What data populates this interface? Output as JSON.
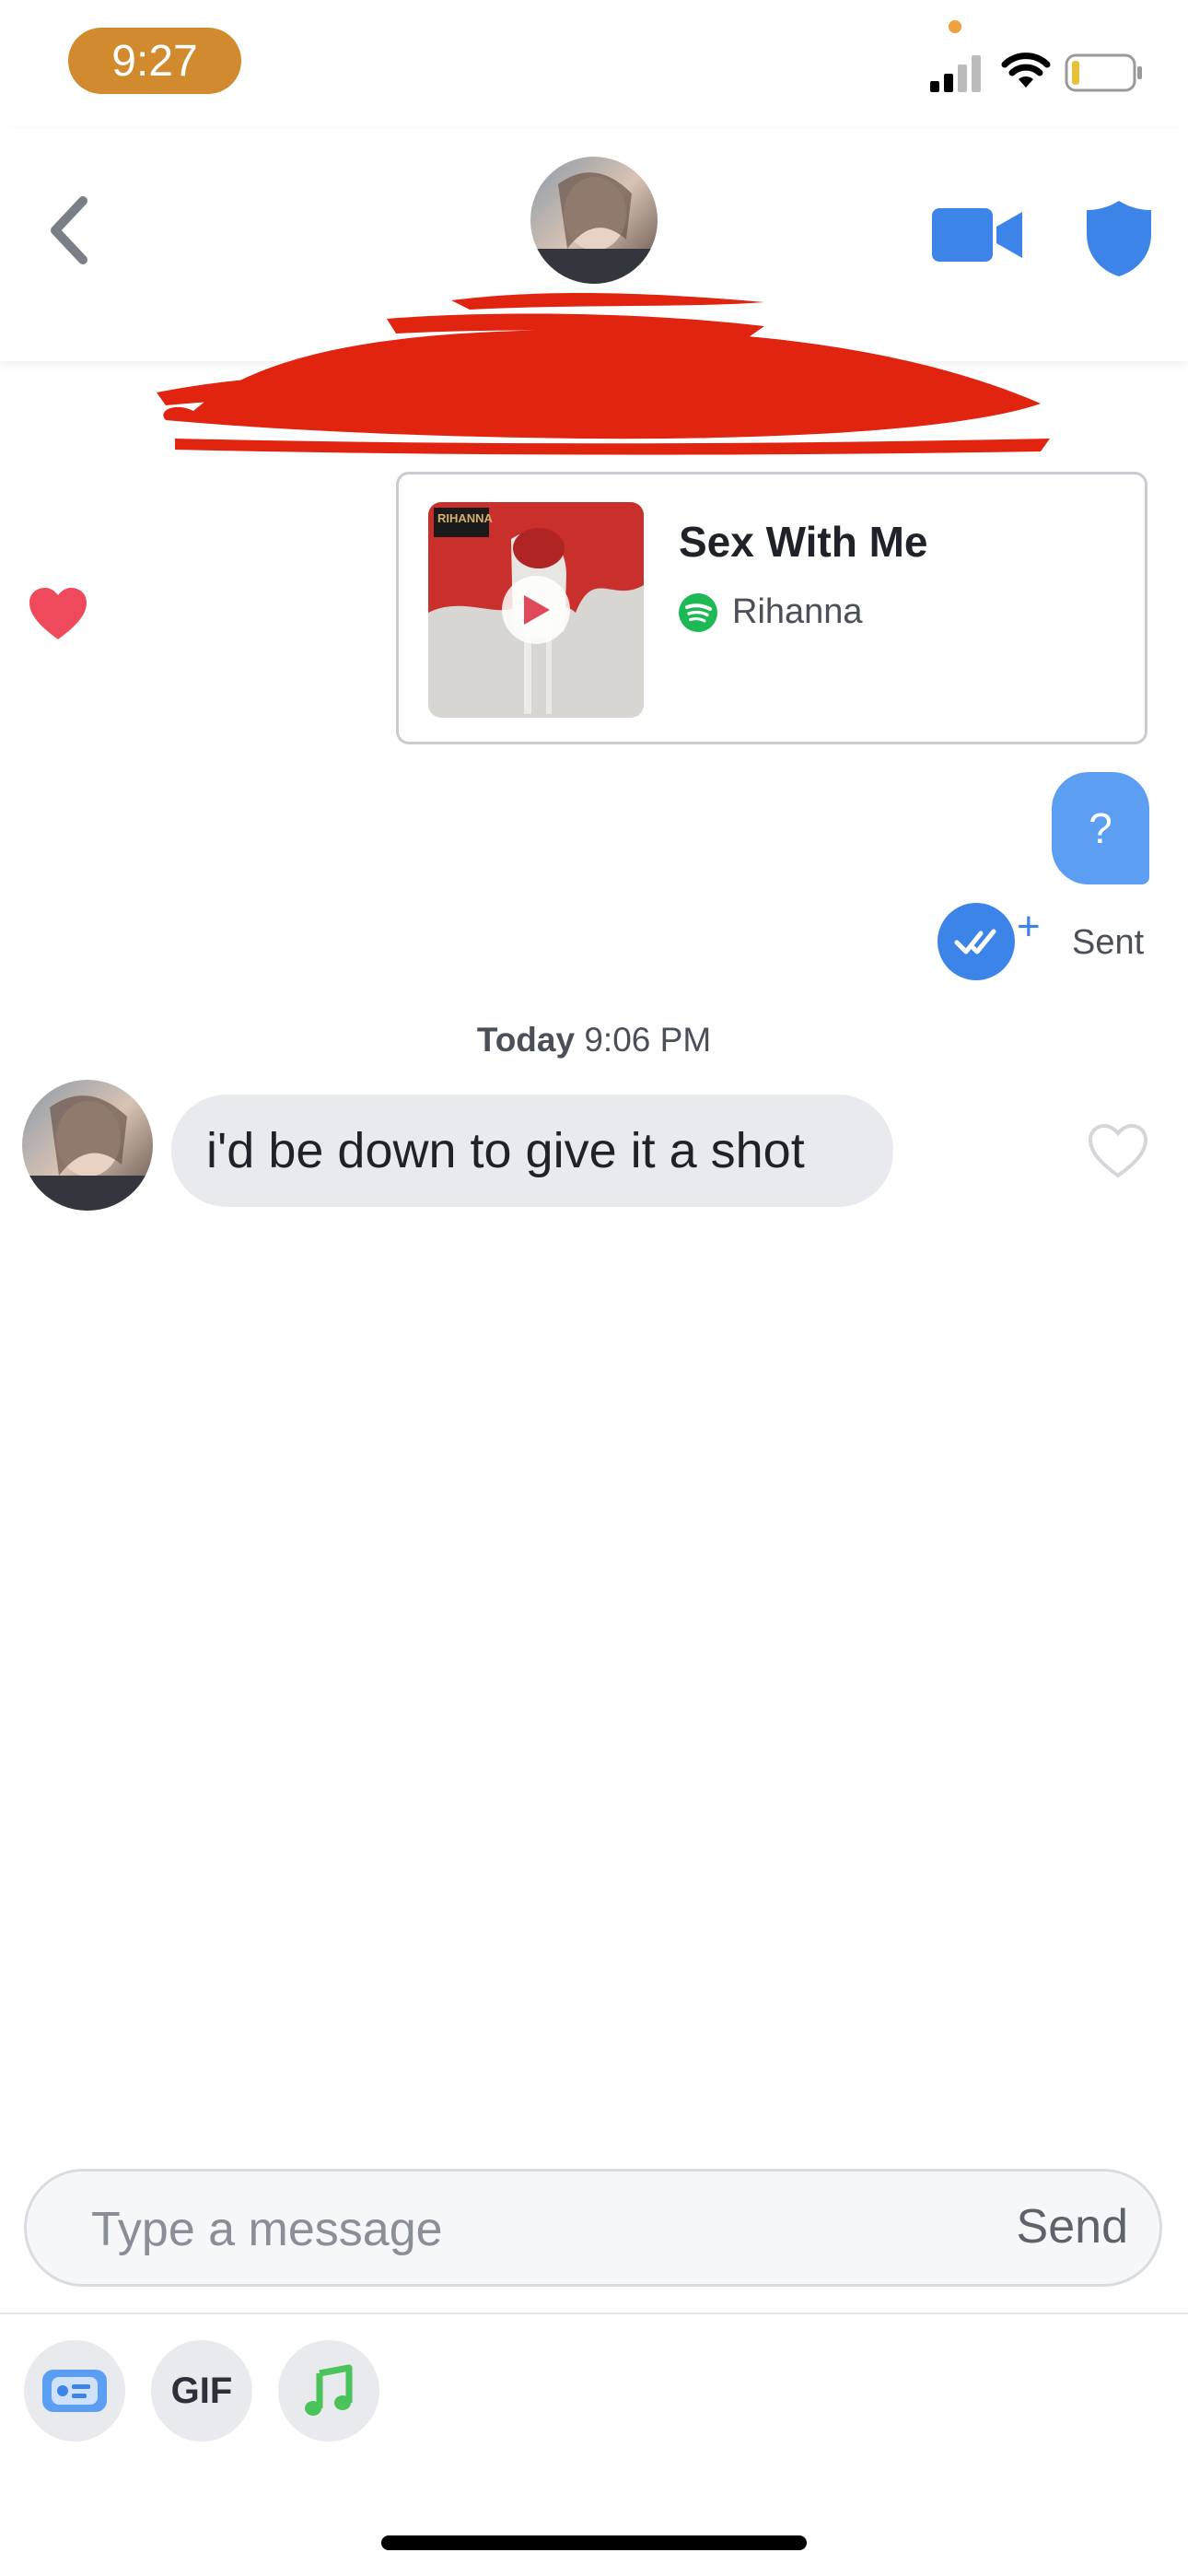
{
  "status_bar": {
    "time": "9:27",
    "time_pill_color": "#d18a2e"
  },
  "header": {
    "back_icon": "chevron-left-icon",
    "video_icon": "video-camera-icon",
    "safety_icon": "shield-icon",
    "accent": "#3d84e8"
  },
  "messages": {
    "spotify_card": {
      "song_title": "Sex With Me",
      "artist": "Rihanna",
      "album_label": "RIHANNA",
      "service_icon": "spotify-icon",
      "service_color": "#1db954"
    },
    "sent_message": {
      "text": "?"
    },
    "receipt": {
      "plus": "+",
      "label": "Sent"
    },
    "timestamp": {
      "day": "Today",
      "time": "9:06 PM"
    },
    "received_message": {
      "text": "i'd be down to give it a shot"
    }
  },
  "composer": {
    "placeholder": "Type a message",
    "send_label": "Send"
  },
  "toolbar": {
    "gif_label": "GIF",
    "sticker_icon": "sticker-card-icon",
    "music_icon": "music-note-icon"
  }
}
